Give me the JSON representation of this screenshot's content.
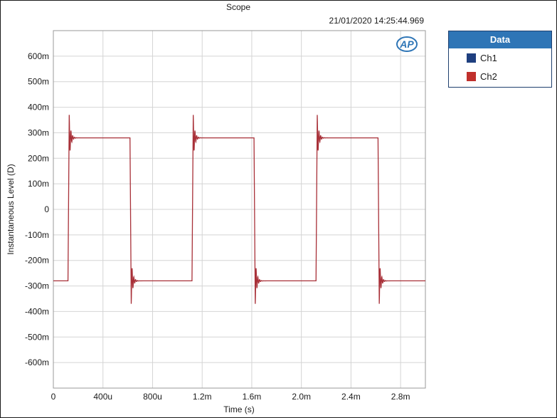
{
  "colors": {
    "ch1": "#1f3f7f",
    "ch2": "#c0302c",
    "trace": "#a83038",
    "grid": "#d4d4d4",
    "legend_header": "#2e75b6"
  },
  "legend": {
    "title": "Data",
    "items": [
      {
        "label": "Ch1",
        "color": "#1f3f7f"
      },
      {
        "label": "Ch2",
        "color": "#c0302c"
      }
    ]
  },
  "logo": {
    "text": "AP"
  },
  "chart_data": {
    "type": "line",
    "title": "Scope",
    "timestamp": "21/01/2020 14:25:44.969",
    "xlabel": "Time (s)",
    "ylabel": "Instantaneous Level (D)",
    "xlim": [
      0,
      0.003
    ],
    "ylim": [
      -0.7,
      0.7
    ],
    "x_ticks": [
      0,
      0.0004,
      0.0008,
      0.0012,
      0.0016,
      0.002,
      0.0024,
      0.0028
    ],
    "x_tick_labels": [
      "0",
      "400u",
      "800u",
      "1.2m",
      "1.6m",
      "2.0m",
      "2.4m",
      "2.8m"
    ],
    "y_ticks": [
      0.6,
      0.5,
      0.4,
      0.3,
      0.2,
      0.1,
      0,
      -0.1,
      -0.2,
      -0.3,
      -0.4,
      -0.5,
      -0.6
    ],
    "y_tick_labels": [
      "600m",
      "500m",
      "400m",
      "300m",
      "200m",
      "100m",
      "0",
      "-100m",
      "-200m",
      "-300m",
      "-400m",
      "-500m",
      "-600m"
    ],
    "grid": true,
    "legend_position": "right",
    "series": [
      {
        "name": "Ch2",
        "waveform": "square",
        "high_level": 0.28,
        "low_level": -0.28,
        "peak_overshoot": 0.37,
        "rising_edges": [
          0.000128,
          0.001128,
          0.002128
        ],
        "falling_edges": [
          0.000628,
          0.001628,
          0.002628
        ]
      }
    ]
  }
}
